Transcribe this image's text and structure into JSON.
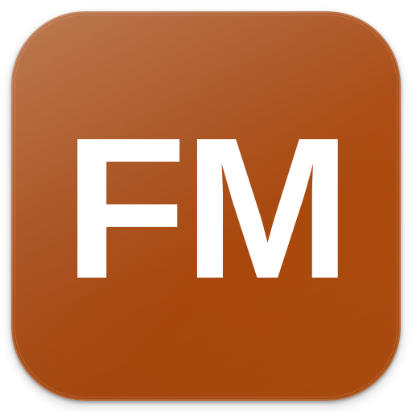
{
  "app_icon": {
    "monogram": "FM",
    "background_color": "#a9501a",
    "text_color": "#ffffff"
  }
}
